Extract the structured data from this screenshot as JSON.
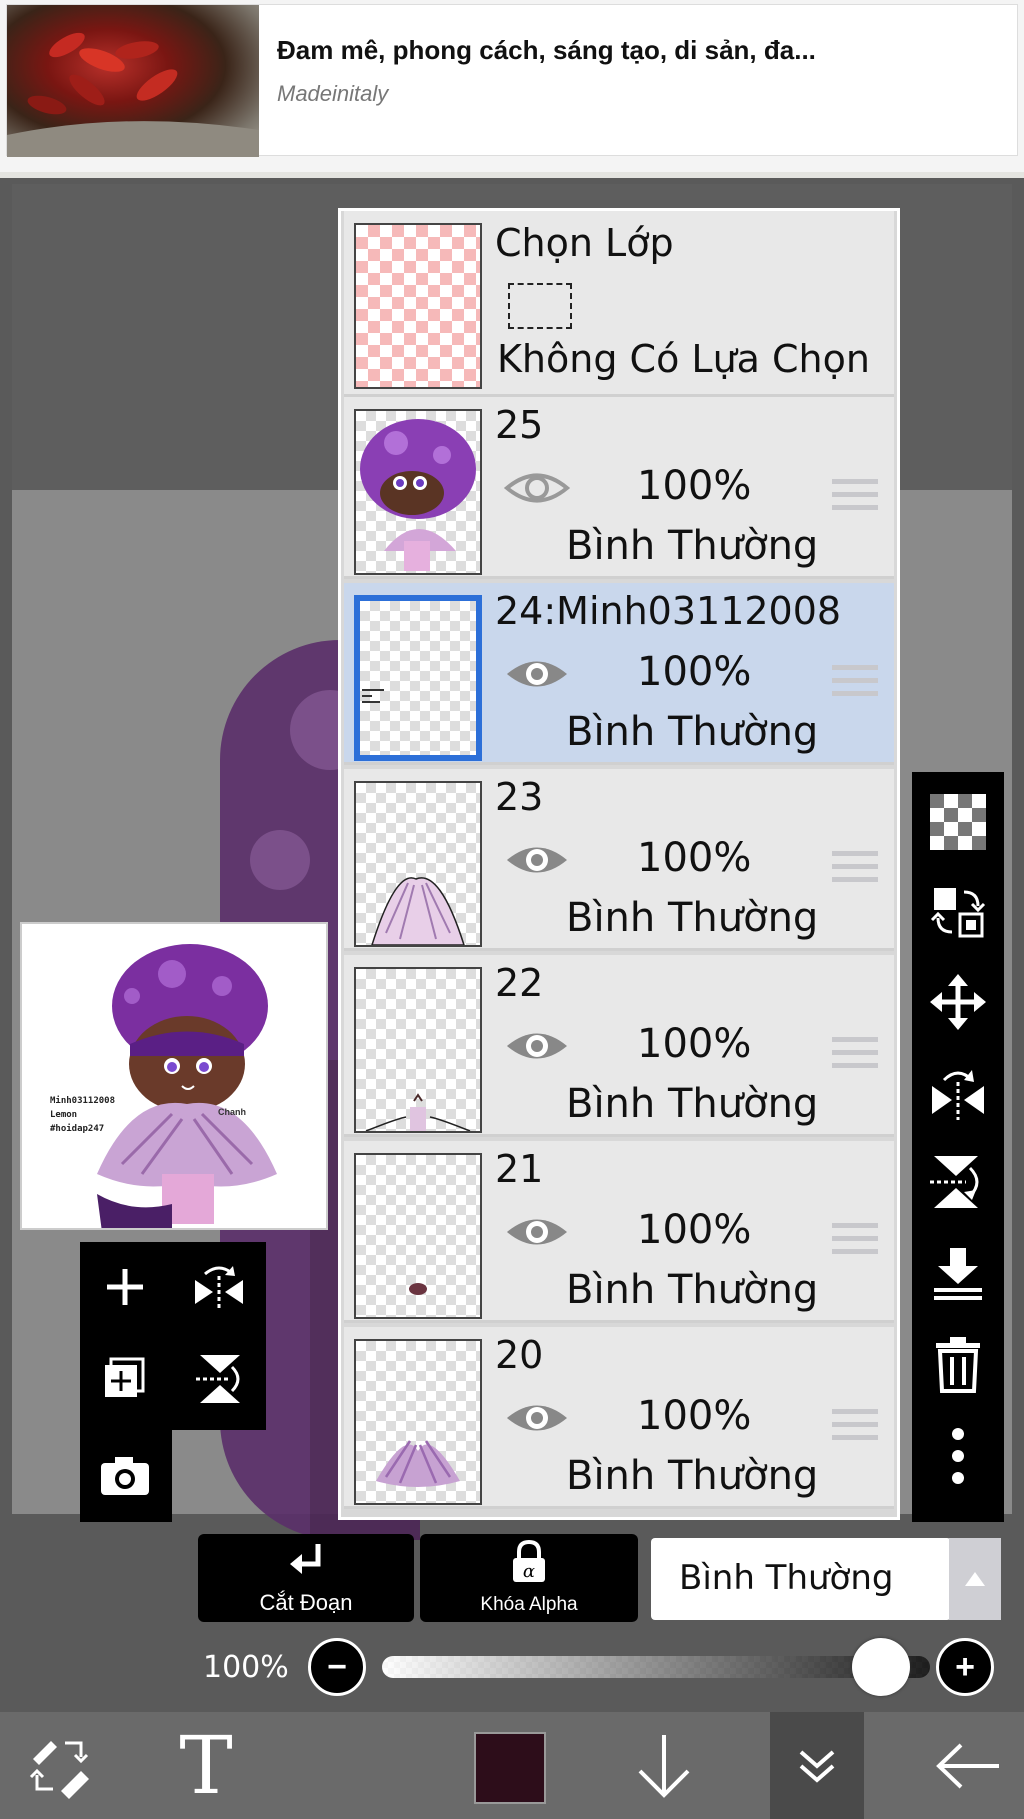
{
  "ad": {
    "title": "Đam mê, phong cách, sáng tạo, di sản, đa...",
    "source": "Madeinitaly"
  },
  "preview": {
    "text_lines": [
      "Minh03112008",
      "Lemon",
      "#hoidap247"
    ],
    "signature": "Chanh"
  },
  "layers_panel": {
    "selection_layer": {
      "title": "Chọn Lớp",
      "status": "Không Có Lựa Chọn"
    },
    "layers": [
      {
        "name": "25",
        "opacity": "100%",
        "blend": "Bình Thường",
        "visible": true,
        "selected": false
      },
      {
        "name": "24:Minh03112008",
        "opacity": "100%",
        "blend": "Bình Thường",
        "visible": true,
        "selected": true
      },
      {
        "name": "23",
        "opacity": "100%",
        "blend": "Bình Thường",
        "visible": true,
        "selected": false
      },
      {
        "name": "22",
        "opacity": "100%",
        "blend": "Bình Thường",
        "visible": true,
        "selected": false
      },
      {
        "name": "21",
        "opacity": "100%",
        "blend": "Bình Thường",
        "visible": true,
        "selected": false
      },
      {
        "name": "20",
        "opacity": "100%",
        "blend": "Bình Thường",
        "visible": true,
        "selected": false
      }
    ]
  },
  "left_palette": {
    "icons": [
      "plus-icon",
      "flip-horizontal-icon",
      "add-layer-copy-icon",
      "flip-vertical-icon",
      "camera-icon"
    ]
  },
  "right_toolbar": {
    "icons": [
      "transparent-fill-icon",
      "swap-layers-icon",
      "move-icon",
      "flip-horizontal-icon",
      "flip-vertical-icon",
      "merge-down-icon",
      "trash-icon",
      "more-icon"
    ]
  },
  "controls": {
    "clipping_label": "Cắt Đoạn",
    "alpha_lock_label": "Khóa Alpha",
    "blend_mode": "Bình Thường",
    "opacity_label": "100%",
    "opacity_value": 1.0,
    "minus": "−",
    "plus": "+"
  },
  "bottom_nav": {
    "icons": [
      "tool-swap-icon",
      "text-icon",
      "color-swatch",
      "arrow-down-icon",
      "collapse-icon",
      "back-arrow-icon"
    ],
    "text_tool_label": "T",
    "current_color": "#2d0d1a"
  },
  "colors": {
    "selected_row": "#c9d7ec",
    "selected_border": "#2c6fd8",
    "panel_bg": "#e8e8e8"
  }
}
